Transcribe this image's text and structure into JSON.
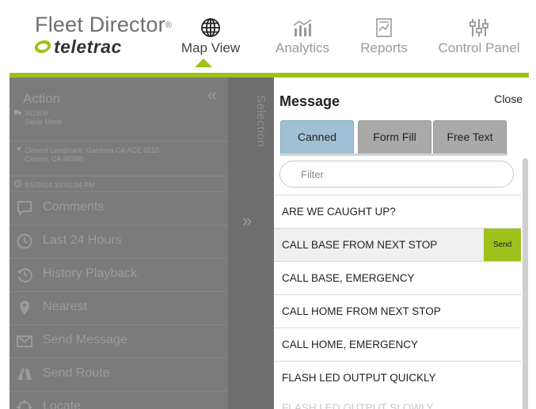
{
  "header": {
    "brand_name": "Fleet Director",
    "brand_reg": "®",
    "brand_sub": "teletrac",
    "nav": [
      {
        "label": "Map View",
        "icon": "globe-icon",
        "active": true
      },
      {
        "label": "Analytics",
        "icon": "analytics-icon",
        "active": false
      },
      {
        "label": "Reports",
        "icon": "reports-icon",
        "active": false
      },
      {
        "label": "Control Panel",
        "icon": "sliders-icon",
        "active": false
      }
    ],
    "accent_color": "#9dc21b"
  },
  "action_panel": {
    "title": "Action",
    "collapse_glyph": "«",
    "vehicle_id": "311906",
    "vehicle_status": "Sleep Mode",
    "landmark": "Closest Landmark: Gardena CA ACE 0215",
    "address": "Carson, CA 90248",
    "timestamp": "8/5/2014 10:01:34 PM",
    "menu": [
      {
        "label": "Comments",
        "icon": "comment-icon"
      },
      {
        "label": "Last 24 Hours",
        "icon": "clock-icon"
      },
      {
        "label": "History Playback",
        "icon": "history-icon"
      },
      {
        "label": "Nearest",
        "icon": "map-pin-icon"
      },
      {
        "label": "Send Message",
        "icon": "envelope-icon"
      },
      {
        "label": "Send Route",
        "icon": "route-icon"
      },
      {
        "label": "Locate",
        "icon": "locate-icon"
      }
    ]
  },
  "selection": {
    "label": "Selection",
    "expand_glyph": "»"
  },
  "message": {
    "title": "Message",
    "close_label": "Close",
    "tabs": [
      {
        "label": "Canned",
        "active": true
      },
      {
        "label": "Form Fill",
        "active": false
      },
      {
        "label": "Free Text",
        "active": false
      }
    ],
    "filter_placeholder": "Filter",
    "send_label": "Send",
    "items": [
      "ARE WE CAUGHT UP?",
      "CALL BASE FROM NEXT STOP",
      "CALL BASE, EMERGENCY",
      "CALL HOME FROM NEXT STOP",
      "CALL HOME, EMERGENCY",
      "FLASH LED OUTPUT QUICKLY"
    ],
    "selected_index": 1,
    "cutoff_item": "FLASH LED OUTPUT SLOWLY"
  }
}
